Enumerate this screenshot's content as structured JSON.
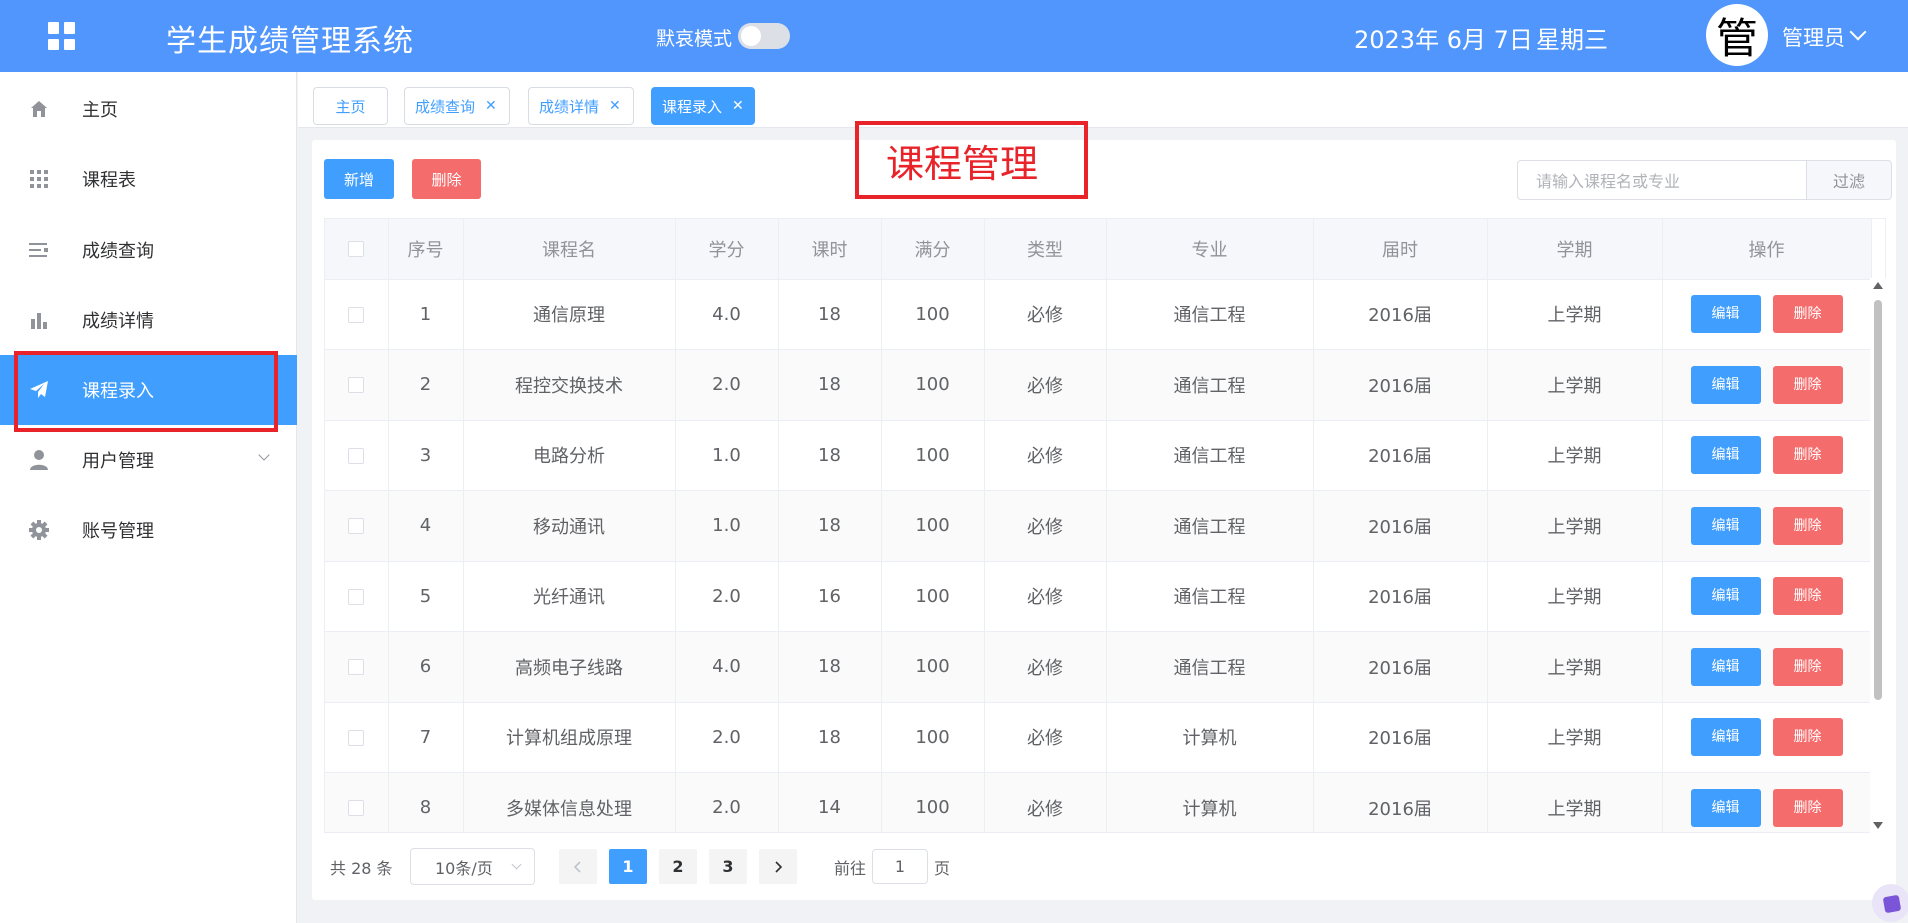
{
  "header": {
    "title": "学生成绩管理系统",
    "mourning_mode_label": "默哀模式",
    "mourning_mode_on": false,
    "date": "2023年 6月 7日",
    "weekday": "星期三",
    "avatar_char": "管",
    "user_name": "管理员"
  },
  "sidebar": {
    "items": [
      {
        "label": "主页",
        "icon": "home-icon"
      },
      {
        "label": "课程表",
        "icon": "grid-icon"
      },
      {
        "label": "成绩查询",
        "icon": "list-icon"
      },
      {
        "label": "成绩详情",
        "icon": "bar-chart-icon"
      },
      {
        "label": "课程录入",
        "icon": "paper-plane-icon",
        "active": true
      },
      {
        "label": "用户管理",
        "icon": "user-icon",
        "has_submenu": true
      },
      {
        "label": "账号管理",
        "icon": "gear-icon"
      }
    ]
  },
  "tabs": [
    {
      "label": "主页",
      "closable": false
    },
    {
      "label": "成绩查询",
      "closable": true
    },
    {
      "label": "成绩详情",
      "closable": true
    },
    {
      "label": "课程录入",
      "closable": true,
      "active": true
    }
  ],
  "annotation_title": "课程管理",
  "toolbar": {
    "add_label": "新增",
    "delete_label": "删除",
    "search_placeholder": "请输入课程名或专业",
    "filter_label": "过滤"
  },
  "table": {
    "headers": [
      "序号",
      "课程名",
      "学分",
      "课时",
      "满分",
      "类型",
      "专业",
      "届时",
      "学期",
      "操作"
    ],
    "edit_label": "编辑",
    "delete_label": "删除",
    "rows": [
      [
        "1",
        "通信原理",
        "4.0",
        "18",
        "100",
        "必修",
        "通信工程",
        "2016届",
        "上学期"
      ],
      [
        "2",
        "程控交换技术",
        "2.0",
        "18",
        "100",
        "必修",
        "通信工程",
        "2016届",
        "上学期"
      ],
      [
        "3",
        "电路分析",
        "1.0",
        "18",
        "100",
        "必修",
        "通信工程",
        "2016届",
        "上学期"
      ],
      [
        "4",
        "移动通讯",
        "1.0",
        "18",
        "100",
        "必修",
        "通信工程",
        "2016届",
        "上学期"
      ],
      [
        "5",
        "光纤通讯",
        "2.0",
        "16",
        "100",
        "必修",
        "通信工程",
        "2016届",
        "上学期"
      ],
      [
        "6",
        "高频电子线路",
        "4.0",
        "18",
        "100",
        "必修",
        "通信工程",
        "2016届",
        "上学期"
      ],
      [
        "7",
        "计算机组成原理",
        "2.0",
        "18",
        "100",
        "必修",
        "计算机",
        "2016届",
        "上学期"
      ],
      [
        "8",
        "多媒体信息处理",
        "2.0",
        "14",
        "100",
        "必修",
        "计算机",
        "2016届",
        "上学期"
      ]
    ]
  },
  "pagination": {
    "total_text": "共 28 条",
    "page_size": "10条/页",
    "pages": [
      "1",
      "2",
      "3"
    ],
    "current_page": "1",
    "goto_label": "前往",
    "goto_value": "1",
    "page_suffix": "页"
  },
  "colors": {
    "header": "#5196fc",
    "primary": "#409eff",
    "danger": "#f56c6c",
    "annotation": "#e8232a"
  }
}
